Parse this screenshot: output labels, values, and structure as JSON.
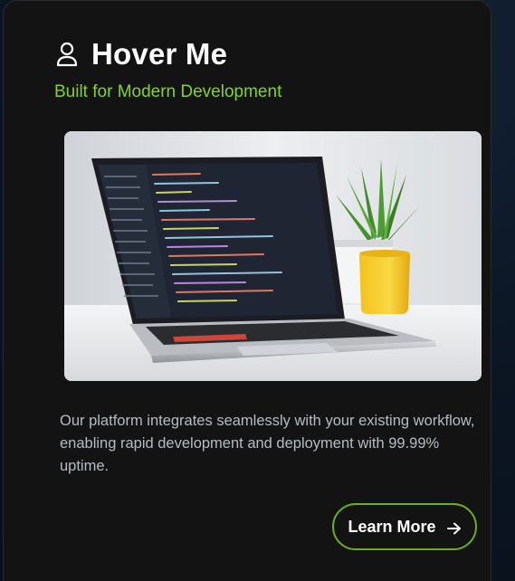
{
  "card": {
    "title": "Hover Me",
    "subtitle": "Built for Modern Development",
    "description": "Our platform integrates seamlessly with your existing workflow, enabling rapid development and deployment with 99.99% uptime.",
    "button_label": "Learn More",
    "icons": {
      "title_icon": "user-icon",
      "button_icon": "arrow-right-icon"
    }
  },
  "colors": {
    "accent": "#84d51a",
    "button_border": "#6bb019",
    "card_bg": "#131313",
    "text_muted": "#b6bcc3"
  }
}
